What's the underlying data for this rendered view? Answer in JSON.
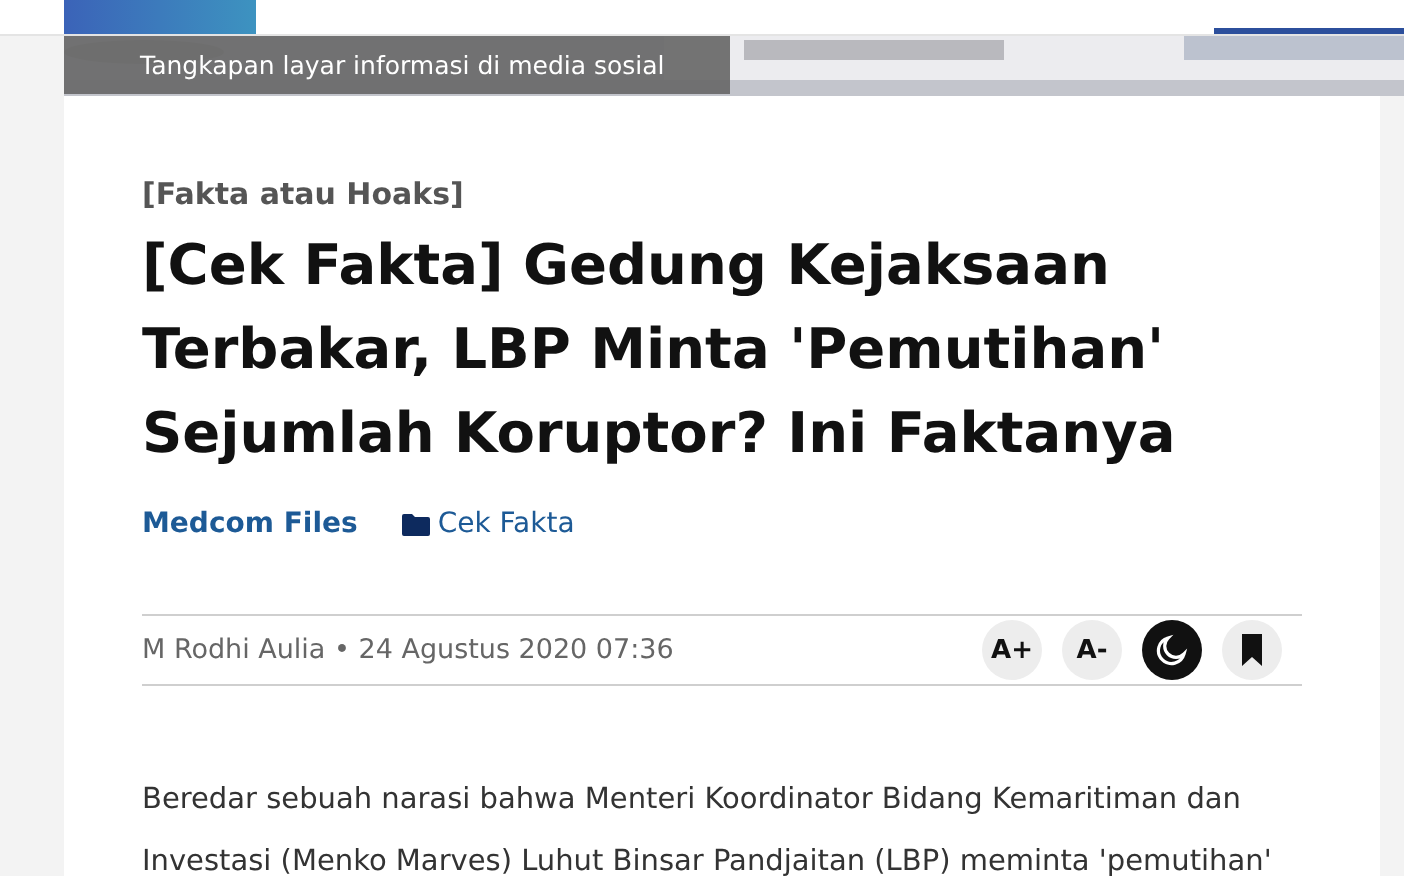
{
  "hero": {
    "caption": "Tangkapan layar informasi di media sosial"
  },
  "article": {
    "category": "[Fakta atau Hoaks]",
    "title": "[Cek Fakta] Gedung Kejaksaan Terbakar, LBP Minta 'Pemutihan' Sejumlah Koruptor? Ini Faktanya",
    "source": "Medcom Files",
    "section": "Cek Fakta",
    "byline": "M Rodhi Aulia • 24 Agustus 2020 07:36",
    "tools": [
      {
        "kind": "text",
        "label": "A+",
        "on": false
      },
      {
        "kind": "text",
        "label": "A-",
        "on": false
      },
      {
        "kind": "moon",
        "on": true
      },
      {
        "kind": "bookmark",
        "on": false
      }
    ],
    "body": "Beredar sebuah narasi bahwa Menteri Koordinator Bidang Kemaritiman dan Investasi (Menko Marves) Luhut Binsar Pandjaitan (LBP) meminta 'pemutihan'"
  }
}
